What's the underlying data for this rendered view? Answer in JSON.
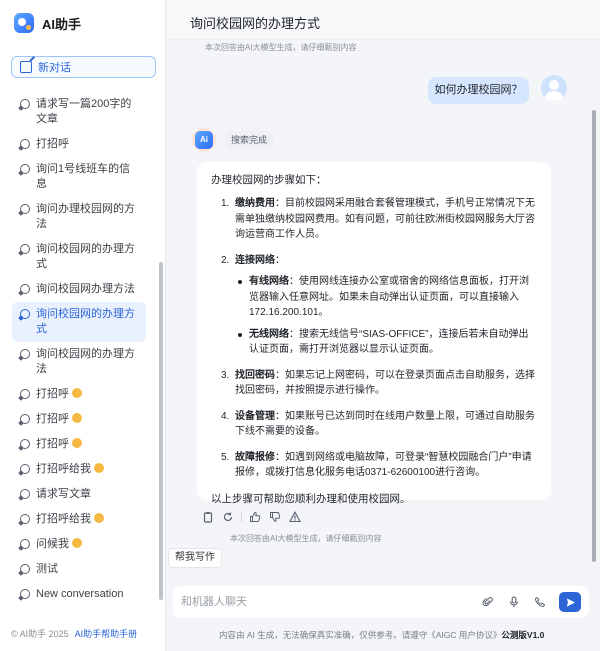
{
  "brand": {
    "name": "AI助手"
  },
  "sidebar": {
    "new_chat_label": "新对话",
    "items": [
      {
        "label": "请求写一篇200字的文章",
        "emoji": false,
        "active": false
      },
      {
        "label": "打招呼",
        "emoji": false,
        "active": false
      },
      {
        "label": "询问1号线班车的信息",
        "emoji": false,
        "active": false
      },
      {
        "label": "询问办理校园网的方法",
        "emoji": false,
        "active": false
      },
      {
        "label": "询问校园网的办理方式",
        "emoji": false,
        "active": false
      },
      {
        "label": "询问校园网办理方法",
        "emoji": false,
        "active": false
      },
      {
        "label": "询问校园网的办理方式",
        "emoji": false,
        "active": true
      },
      {
        "label": "询问校园网的办理方法",
        "emoji": false,
        "active": false
      },
      {
        "label": "打招呼",
        "emoji": true,
        "active": false
      },
      {
        "label": "打招呼",
        "emoji": true,
        "active": false
      },
      {
        "label": "打招呼",
        "emoji": true,
        "active": false
      },
      {
        "label": "打招呼给我",
        "emoji": true,
        "active": false
      },
      {
        "label": "请求写文章",
        "emoji": false,
        "active": false
      },
      {
        "label": "打招呼给我",
        "emoji": true,
        "active": false
      },
      {
        "label": "问候我",
        "emoji": true,
        "active": false
      },
      {
        "label": "测试",
        "emoji": false,
        "active": false
      },
      {
        "label": "New conversation",
        "emoji": false,
        "active": false
      }
    ],
    "tooltip": "帮我写作",
    "footer_copyright": "© AI助手 2025",
    "footer_link": "AI助手帮助手册"
  },
  "main": {
    "title": "询问校园网的办理方式",
    "notice_top": "本次回答由AI大模型生成，请仔细甄别内容",
    "user_message": "如何办理校园网？",
    "search_status": "搜索完成",
    "answer": {
      "intro": "办理校园网的步骤如下：",
      "steps": [
        {
          "num": "1.",
          "title": "缴纳费用",
          "text": "：目前校园网采用融合套餐管理模式，手机号正常情况下无需单独缴纳校园网费用。如有问题，可前往欧洲街校园网服务大厅咨询运营商工作人员。"
        },
        {
          "num": "2.",
          "title": "连接网络",
          "text": "："
        },
        {
          "num": "3.",
          "title": "找回密码",
          "text": "：如果忘记上网密码，可以在登录页面点击自助服务，选择找回密码，并按照提示进行操作。"
        },
        {
          "num": "4.",
          "title": "设备管理",
          "text": "：如果账号已达到同时在线用户数量上限，可通过自助服务下线不需要的设备。"
        },
        {
          "num": "5.",
          "title": "故障报修",
          "text": "：如遇到网络或电脑故障，可登录“智慧校园融合门户”申请报修，或拨打信息化服务电话0371-62600100进行咨询。"
        }
      ],
      "bullets": [
        {
          "title": "有线网络",
          "text": "：使用网线连接办公室或宿舍的网络信息面板，打开浏览器输入任意网址。如果未自动弹出认证页面，可以直接输入172.16.200.101。"
        },
        {
          "title": "无线网络",
          "text": "：搜索无线信号“SIAS-OFFICE”，连接后若未自动弹出认证页面，需打开浏览器以显示认证页面。"
        }
      ],
      "outro": "以上步骤可帮助您顺利办理和使用校园网。"
    },
    "notice_bottom": "本次回答由AI大模型生成，请仔细甄别内容",
    "input_placeholder": "和机器人聊天",
    "disclaimer_prefix": "内容由 AI 生成，无法确保真实准确，仅供参考。请遵守《AIGC 用户协议》",
    "disclaimer_version": "公测版V1.0"
  },
  "colors": {
    "accent": "#2a64d6",
    "user_bubble": "#d6e6ff",
    "active_item_bg": "#e9f1ff"
  }
}
